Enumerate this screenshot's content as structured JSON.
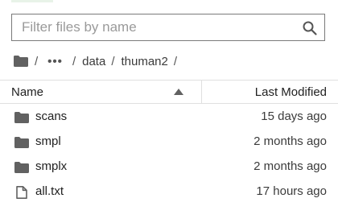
{
  "filter": {
    "placeholder": "Filter files by name"
  },
  "breadcrumb": {
    "separator": "/",
    "ellipsis": "•••",
    "parts": [
      "data",
      "thuman2"
    ]
  },
  "table": {
    "col_name": "Name",
    "col_modified": "Last Modified"
  },
  "files": [
    {
      "name": "scans",
      "modified": "15 days ago",
      "type": "folder"
    },
    {
      "name": "smpl",
      "modified": "2 months ago",
      "type": "folder"
    },
    {
      "name": "smplx",
      "modified": "2 months ago",
      "type": "folder"
    },
    {
      "name": "all.txt",
      "modified": "17 hours ago",
      "type": "file"
    }
  ]
}
